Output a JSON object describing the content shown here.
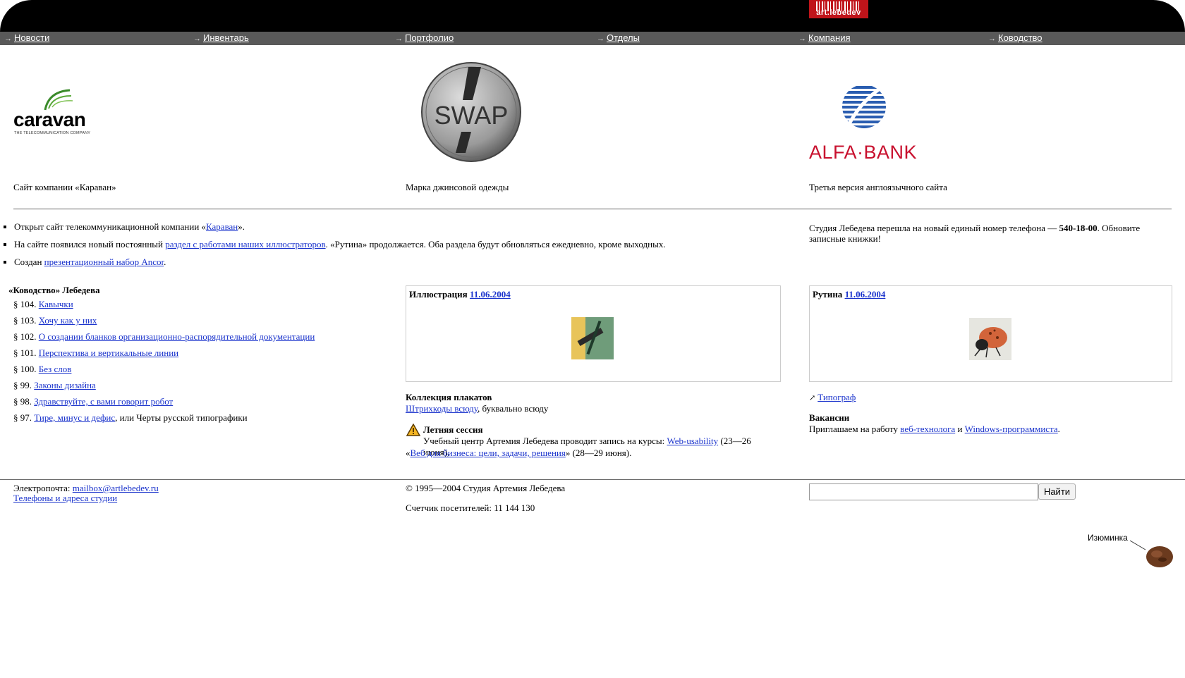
{
  "header": {
    "logo_text": "art.lebedev"
  },
  "nav": [
    {
      "label": "Новости"
    },
    {
      "label": "Инвентарь"
    },
    {
      "label": "Портфолио"
    },
    {
      "label": "Отделы"
    },
    {
      "label": "Компания"
    },
    {
      "label": "Ководство"
    }
  ],
  "portfolio": {
    "caravan": {
      "logo_name": "caravan",
      "logo_sub": "THE TELECOMMUNICATION COMPANY",
      "caption": "Сайт компании «Караван»"
    },
    "swap": {
      "logo_name": "SWAP",
      "caption": "Марка джинсовой одежды"
    },
    "alfa": {
      "logo_name": "ALFA·BANK",
      "caption": "Третья версия англоязычного сайта"
    }
  },
  "news": {
    "item1": {
      "pre": "Открыт сайт телекоммуникационной компании «",
      "link": "Караван",
      "post": "»."
    },
    "item2": {
      "pre": "На сайте появился новый постоянный ",
      "link": "раздел с работами наших иллюстраторов",
      "post": ". «Рутина» продолжается. Оба раздела будут обновляться ежедневно, кроме выходных."
    },
    "item3": {
      "pre": "Создан ",
      "link": "презентационный набор Ancor",
      "post": "."
    }
  },
  "phone": {
    "pre": "Студия Лебедева перешла на новый единый номер телефона — ",
    "number": "540-18-00",
    "post": ". Обновите записные книжки!"
  },
  "kovodstvo": {
    "title": "«Ководство» Лебедева",
    "items": [
      {
        "num": "§ 104. ",
        "link": "Кавычки",
        "post": ""
      },
      {
        "num": "§ 103. ",
        "link": "Хочу как у них",
        "post": ""
      },
      {
        "num": "§ 102. ",
        "link": "О создании бланков организационно-распорядительной документации",
        "post": ""
      },
      {
        "num": "§ 101. ",
        "link": "Перспектива и вертикальные линии",
        "post": ""
      },
      {
        "num": "§ 100. ",
        "link": "Без слов",
        "post": ""
      },
      {
        "num": "§ 99. ",
        "link": "Законы дизайна",
        "post": ""
      },
      {
        "num": "§ 98. ",
        "link": "Здравствуйте, с вами говорит робот",
        "post": ""
      },
      {
        "num": "§ 97. ",
        "link": "Тире, минус и дефис",
        "post": ", или Черты русской типографики"
      }
    ]
  },
  "illustration": {
    "title": "Иллюстрация ",
    "date": "11.06.2004"
  },
  "rutina": {
    "title": "Рутина ",
    "date": "11.06.2004"
  },
  "posters": {
    "title": "Коллекция плакатов",
    "link": "Штрихкоды всюду",
    "post": ", буквально всюду"
  },
  "summer": {
    "title": "Летняя сессия",
    "text": "Учебный центр Артемия Лебедева проводит запись на курсы: ",
    "link1": "Web-usability",
    "mid": " (23—26 июня),",
    "pre2": "«",
    "link2": "Веб для бизнеса: цели, задачи, решения",
    "post2": "» (28—29 июня)."
  },
  "tipograf": {
    "link": "Типограф"
  },
  "jobs": {
    "title": "Вакансии",
    "pre": "Приглашаем на работу ",
    "link1": "веб-технолога",
    "mid": " и ",
    "link2": "Windows-программиста",
    "post": "."
  },
  "footer": {
    "email_label": "Электропочта: ",
    "email": "mailbox@artlebedev.ru",
    "contacts": "Телефоны и адреса студии",
    "copyright": "© 1995—2004 Студия Артемия Лебедева",
    "counter": "Счетчик посетителей: 11 144 130",
    "search_value": "",
    "search_button": "Найти"
  },
  "raisin": {
    "label": "Изюминка"
  },
  "colors": {
    "link": "#1a33cc",
    "alfa_red": "#c8102e",
    "alfa_blue": "#2a5db0",
    "brand_red": "#c0141a"
  }
}
